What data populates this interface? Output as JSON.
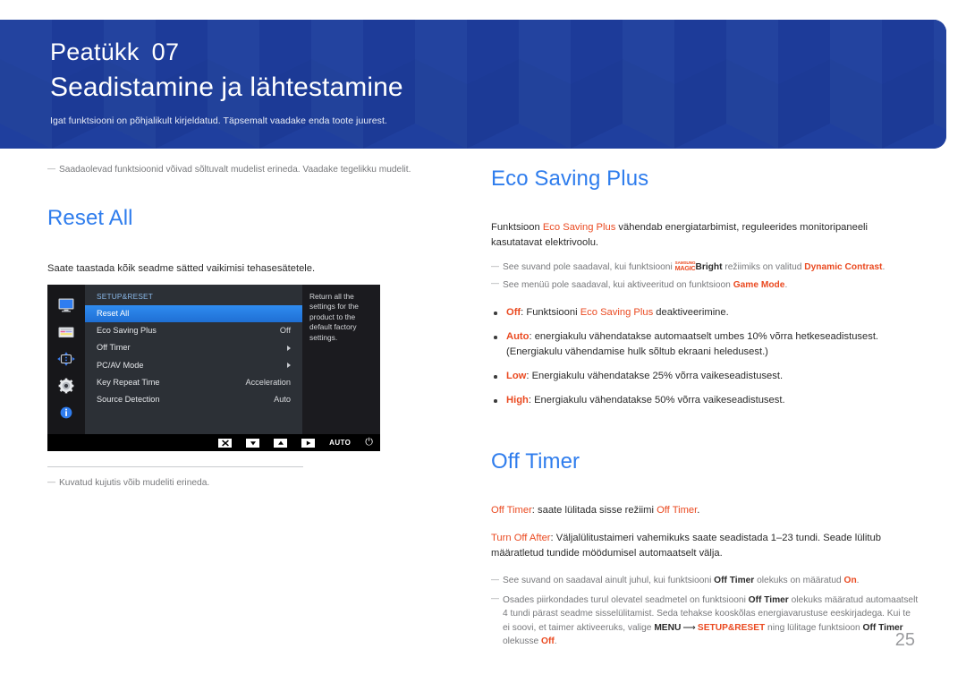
{
  "header": {
    "chapter_label": "Peatükk",
    "chapter_number": "07",
    "title": "Seadistamine ja lähtestamine",
    "subtitle": "Igat funktsiooni on põhjalikult kirjeldatud. Täpsemalt vaadake enda toote juurest.",
    "bg_color": "#1f3f9e"
  },
  "left_column": {
    "top_note": "Saadaolevad funktsioonid võivad sõltuvalt mudelist erineda. Vaadake tegelikku mudelit.",
    "section_title": "Reset All",
    "paragraph": "Saate taastada kõik seadme sätted vaikimisi tehasesätetele.",
    "figure_caption": "Kuvatud kujutis võib mudeliti erineda."
  },
  "osd": {
    "menu_heading": "SETUP&RESET",
    "rows": [
      {
        "label": "Reset All",
        "value": "",
        "type": "selected"
      },
      {
        "label": "Eco Saving Plus",
        "value": "Off",
        "type": "value"
      },
      {
        "label": "Off Timer",
        "value": "",
        "type": "submenu"
      },
      {
        "label": "PC/AV Mode",
        "value": "",
        "type": "submenu"
      },
      {
        "label": "Key Repeat Time",
        "value": "Acceleration",
        "type": "value"
      },
      {
        "label": "Source Detection",
        "value": "Auto",
        "type": "value"
      }
    ],
    "help_text": "Return all the settings for the product to the default factory settings.",
    "sidebar_icons": [
      "monitor-icon",
      "color-bars-icon",
      "move-arrows-icon",
      "gear-icon",
      "info-icon"
    ],
    "footer_keys": [
      {
        "name": "close-key",
        "glyph": "✕"
      },
      {
        "name": "down-key",
        "glyph": "▼"
      },
      {
        "name": "up-key",
        "glyph": "▲"
      },
      {
        "name": "enter-key",
        "glyph": "▶"
      }
    ],
    "footer_auto_label": "AUTO",
    "footer_power_glyph": "⏻",
    "highlight_color": "#2f8cf0"
  },
  "right_column": {
    "eco": {
      "title": "Eco Saving Plus",
      "intro_before": "Funktsioon ",
      "intro_term": "Eco Saving Plus",
      "intro_after": " vähendab energiatarbimist, reguleerides monitoripaneeli kasutatavat elektrivoolu.",
      "note1_a": "See suvand pole saadaval, kui funktsiooni ",
      "note1_logo_top": "SAMSUNG",
      "note1_logo_bottom": "MAGIC",
      "note1_logo_word": "Bright",
      "note1_b": " režiimiks on valitud ",
      "note1_term": "Dynamic Contrast",
      "note1_c": ".",
      "note2_a": "See menüü pole saadaval, kui aktiveeritud on funktsioon ",
      "note2_term": "Game Mode",
      "note2_b": ".",
      "bullets": [
        {
          "term": "Off",
          "text": ": Funktsiooni ",
          "term2": "Eco Saving Plus",
          "text2": " deaktiveerimine."
        },
        {
          "term": "Auto",
          "text": ": energiakulu vähendatakse automaatselt umbes 10% võrra hetkeseadistusest. (Energiakulu vähendamise hulk sõltub ekraani heledusest.)",
          "term2": "",
          "text2": ""
        },
        {
          "term": "Low",
          "text": ": Energiakulu vähendatakse 25% võrra vaikeseadistusest.",
          "term2": "",
          "text2": ""
        },
        {
          "term": "High",
          "text": ": Energiakulu vähendatakse 50% võrra vaikeseadistusest.",
          "term2": "",
          "text2": ""
        }
      ]
    },
    "offtimer": {
      "title": "Off Timer",
      "p1_term": "Off Timer",
      "p1_a": ": saate lülitada sisse režiimi ",
      "p1_term2": "Off Timer",
      "p1_b": ".",
      "p2_term": "Turn Off After",
      "p2_text": ": Väljalülitustaimeri vahemikuks saate seadistada 1–23 tundi. Seade lülitub määratletud tundide möödumisel automaatselt välja.",
      "note1_a": "See suvand on saadaval ainult juhul, kui funktsiooni ",
      "note1_term": "Off Timer",
      "note1_b": " olekuks on määratud ",
      "note1_term2": "On",
      "note1_c": ".",
      "note2_a": "Osades piirkondades turul olevatel seadmetel on funktsiooni ",
      "note2_term": "Off Timer",
      "note2_b": " olekuks määratud automaatselt 4 tundi pärast seadme sisselülitamist. Seda tehakse kooskõlas energiavarustuse eeskirjadega. Kui te ei soovi, et taimer aktiveeruks, valige ",
      "note2_menu": "MENU",
      "note2_arrow": "⟶",
      "note2_term2": "SETUP&RESET",
      "note2_c": " ning lülitage funktsioon ",
      "note2_term3": "Off Timer",
      "note2_d": " olekusse ",
      "note2_term4": "Off",
      "note2_e": "."
    }
  },
  "footer": {
    "page_number": "25"
  },
  "colors": {
    "heading_blue": "#2f7ded",
    "accent_orange": "#ea4a21",
    "banner_blue": "#1f3f9e",
    "note_gray": "#77787b"
  }
}
